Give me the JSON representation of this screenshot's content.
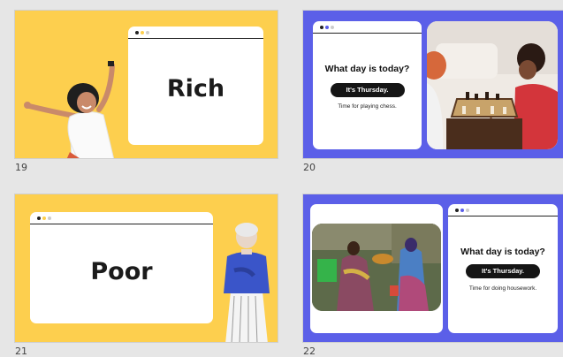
{
  "colors": {
    "yellow": "#fdcf4e",
    "blue": "#5b5fe8",
    "black": "#151515"
  },
  "slides": [
    {
      "number": "19",
      "word": "Rich",
      "illustration": "dancing-woman"
    },
    {
      "number": "20",
      "question": "What day is today?",
      "answer": "It's Thursday.",
      "caption": "Time for playing chess.",
      "photo": "children-playing-chess"
    },
    {
      "number": "21",
      "word": "Poor",
      "illustration": "elderly-woman"
    },
    {
      "number": "22",
      "question": "What day is today?",
      "answer": "It's Thursday.",
      "caption": "Time for doing housework.",
      "photo": "market-street-women"
    }
  ]
}
